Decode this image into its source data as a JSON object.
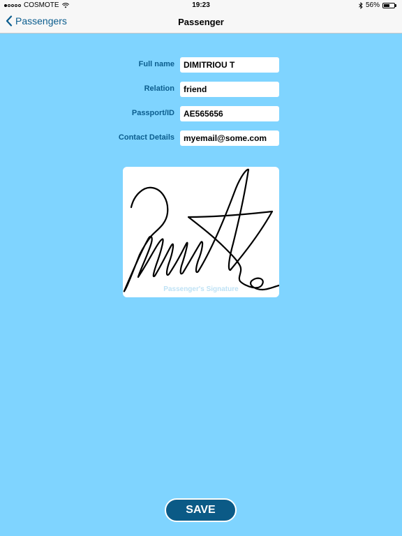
{
  "status_bar": {
    "carrier": "COSMOTE",
    "time": "19:23",
    "battery": "56%",
    "battery_level": 0.56,
    "signal_bars_filled": 1,
    "signal_bars_total": 5,
    "wifi_icon": "wifi-icon",
    "bluetooth_icon": "bluetooth-icon"
  },
  "nav": {
    "back_label": "Passengers",
    "title": "Passenger",
    "accent_color": "#0b5d8e"
  },
  "form": {
    "fields": [
      {
        "label": "Full name",
        "value": "DIMITRIOU T"
      },
      {
        "label": "Relation",
        "value": "friend"
      },
      {
        "label": "Passport/ID",
        "value": "AE565656"
      },
      {
        "label": "Contact Details",
        "value": "myemail@some.com"
      }
    ]
  },
  "signature": {
    "placeholder": "Passenger's Signature"
  },
  "actions": {
    "save_label": "SAVE"
  },
  "colors": {
    "background": "#7fd4ff",
    "button": "#0b5a86",
    "label": "#0b5d8e"
  }
}
